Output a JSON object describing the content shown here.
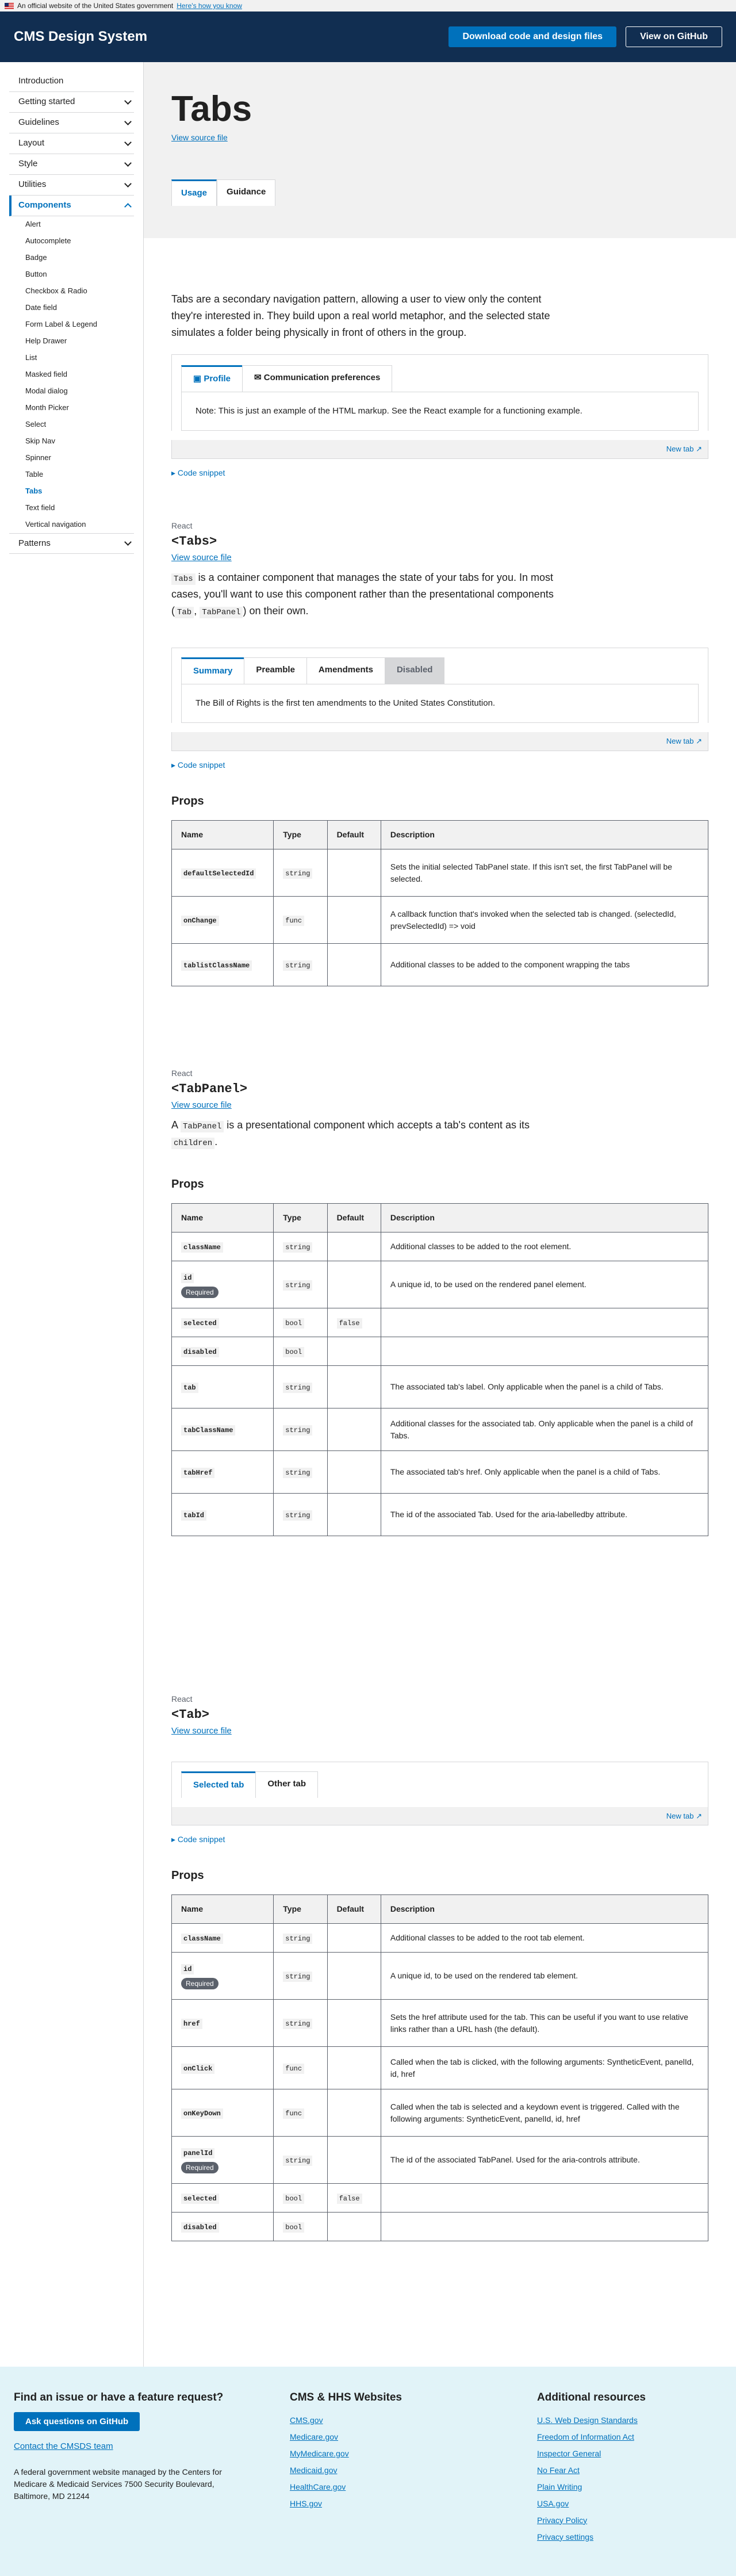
{
  "banner": {
    "text": "An official website of the United States government",
    "link": "Here's how you know"
  },
  "header": {
    "brand": "CMS Design System",
    "download": "Download code and design files",
    "github": "View on GitHub"
  },
  "nav": {
    "top": [
      "Introduction",
      "Getting started",
      "Guidelines",
      "Layout",
      "Style",
      "Utilities"
    ],
    "components": "Components",
    "subs": [
      "Alert",
      "Autocomplete",
      "Badge",
      "Button",
      "Checkbox & Radio",
      "Date field",
      "Form Label & Legend",
      "Help Drawer",
      "List",
      "Masked field",
      "Modal dialog",
      "Month Picker",
      "Select",
      "Skip Nav",
      "Spinner",
      "Table",
      "Tabs",
      "Text field",
      "Vertical navigation"
    ],
    "patterns": "Patterns"
  },
  "hero": {
    "title": "Tabs",
    "source": "View source file",
    "tab_usage": "Usage",
    "tab_guidance": "Guidance"
  },
  "intro": "Tabs are a secondary navigation pattern, allowing a user to view only the content they're interested in. They build upon a real world metaphor, and the selected state simulates a folder being physically in front of others in the group.",
  "ex1": {
    "tab1": "Profile",
    "tab2": "Communication preferences",
    "note": "Note: This is just an example of the HTML markup. See the React example for a functioning example.",
    "newtab": "New tab",
    "snippet": "Code snippet"
  },
  "tabs_section": {
    "react": "React",
    "name": "<Tabs>",
    "source": "View source file",
    "desc_parts": [
      "Tabs",
      "is a container component that manages the state of your tabs for you. In most cases, you'll want to use this component rather than the presentational components (",
      "Tab",
      ",",
      "TabPanel",
      ") on their own."
    ]
  },
  "ex2": {
    "tabs": [
      "Summary",
      "Preamble",
      "Amendments",
      "Disabled"
    ],
    "panel": "The Bill of Rights is the first ten amendments to the United States Constitution.",
    "newtab": "New tab",
    "snippet": "Code snippet"
  },
  "props_title": "Props",
  "headers": [
    "Name",
    "Type",
    "Default",
    "Description"
  ],
  "tabs_props": [
    {
      "name": "defaultSelectedId",
      "type": "string",
      "default": "",
      "desc": "Sets the initial selected TabPanel state. If this isn't set, the first TabPanel will be selected."
    },
    {
      "name": "onChange",
      "type": "func",
      "default": "",
      "desc": "A callback function that's invoked when the selected tab is changed. (selectedId, prevSelectedId) => void"
    },
    {
      "name": "tablistClassName",
      "type": "string",
      "default": "",
      "desc": "Additional classes to be added to the component wrapping the tabs"
    }
  ],
  "panel_section": {
    "react": "React",
    "name": "<TabPanel>",
    "source": "View source file",
    "desc_a": "A",
    "desc_code": "TabPanel",
    "desc_b": "is a presentational component which accepts a tab's content as its",
    "desc_code2": "children",
    "desc_c": "."
  },
  "panel_props": [
    {
      "name": "className",
      "type": "string",
      "default": "",
      "desc": "Additional classes to be added to the root element."
    },
    {
      "name": "id",
      "required": "Required",
      "type": "string",
      "default": "",
      "desc": "A unique id, to be used on the rendered panel element."
    },
    {
      "name": "selected",
      "type": "bool",
      "default": "false",
      "desc": ""
    },
    {
      "name": "disabled",
      "type": "bool",
      "default": "",
      "desc": ""
    },
    {
      "name": "tab",
      "type": "string",
      "default": "",
      "desc": "The associated tab's label. Only applicable when the panel is a child of Tabs."
    },
    {
      "name": "tabClassName",
      "type": "string",
      "default": "",
      "desc": "Additional classes for the associated tab. Only applicable when the panel is a child of Tabs."
    },
    {
      "name": "tabHref",
      "type": "string",
      "default": "",
      "desc": "The associated tab's href. Only applicable when the panel is a child of Tabs."
    },
    {
      "name": "tabId",
      "type": "string",
      "default": "",
      "desc": "The id of the associated Tab. Used for the aria-labelledby attribute."
    }
  ],
  "tab_section": {
    "react": "React",
    "name": "<Tab>",
    "source": "View source file"
  },
  "ex3": {
    "tab1": "Selected tab",
    "tab2": "Other tab",
    "newtab": "New tab",
    "snippet": "Code snippet"
  },
  "tab_props": [
    {
      "name": "className",
      "type": "string",
      "default": "",
      "desc": "Additional classes to be added to the root tab element."
    },
    {
      "name": "id",
      "required": "Required",
      "type": "string",
      "default": "",
      "desc": "A unique id, to be used on the rendered tab element."
    },
    {
      "name": "href",
      "type": "string",
      "default": "",
      "desc": "Sets the href attribute used for the tab. This can be useful if you want to use relative links rather than a URL hash (the default)."
    },
    {
      "name": "onClick",
      "type": "func",
      "default": "",
      "desc": "Called when the tab is clicked, with the following arguments: SyntheticEvent, panelId, id, href"
    },
    {
      "name": "onKeyDown",
      "type": "func",
      "default": "",
      "desc": "Called when the tab is selected and a keydown event is triggered. Called with the following arguments: SyntheticEvent, panelId, id, href"
    },
    {
      "name": "panelId",
      "required": "Required",
      "type": "string",
      "default": "",
      "desc": "The id of the associated TabPanel. Used for the aria-controls attribute."
    },
    {
      "name": "selected",
      "type": "bool",
      "default": "false",
      "desc": ""
    },
    {
      "name": "disabled",
      "type": "bool",
      "default": "",
      "desc": ""
    }
  ],
  "footer": {
    "issue_title": "Find an issue or have a feature request?",
    "issue_btn": "Ask questions on GitHub",
    "contact": "Contact the CMSDS team",
    "address": "A federal government website managed by the Centers for Medicare & Medicaid Services 7500 Security Boulevard, Baltimore, MD 21244",
    "cms_title": "CMS & HHS Websites",
    "cms_links": [
      "CMS.gov",
      "Medicare.gov",
      "MyMedicare.gov",
      "Medicaid.gov",
      "HealthCare.gov",
      "HHS.gov"
    ],
    "res_title": "Additional resources",
    "res_links": [
      "U.S. Web Design Standards",
      "Freedom of Information Act",
      "Inspector General",
      "No Fear Act",
      "Plain Writing",
      "USA.gov",
      "Privacy Policy",
      "Privacy settings"
    ]
  }
}
